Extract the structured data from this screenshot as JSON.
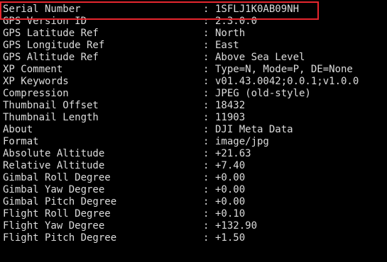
{
  "accent": {
    "highlight_border": "#e6262e",
    "text": "#dcdcdc",
    "background": "#000000"
  },
  "rows": [
    {
      "label": "Serial Number",
      "value": "1SFLJ1K0AB09NH"
    },
    {
      "label": "GPS Version ID",
      "value": "2.3.0.0"
    },
    {
      "label": "GPS Latitude Ref",
      "value": "North"
    },
    {
      "label": "GPS Longitude Ref",
      "value": "East"
    },
    {
      "label": "GPS Altitude Ref",
      "value": "Above Sea Level"
    },
    {
      "label": "XP Comment",
      "value": "Type=N, Mode=P, DE=None"
    },
    {
      "label": "XP Keywords",
      "value": "v01.43.0042;0.0.1;v1.0.0"
    },
    {
      "label": "Compression",
      "value": "JPEG (old-style)"
    },
    {
      "label": "Thumbnail Offset",
      "value": "18432"
    },
    {
      "label": "Thumbnail Length",
      "value": "11903"
    },
    {
      "label": "About",
      "value": "DJI Meta Data"
    },
    {
      "label": "Format",
      "value": "image/jpg"
    },
    {
      "label": "Absolute Altitude",
      "value": "+21.63"
    },
    {
      "label": "Relative Altitude",
      "value": "+7.40"
    },
    {
      "label": "Gimbal Roll Degree",
      "value": "+0.00"
    },
    {
      "label": "Gimbal Yaw Degree",
      "value": "+0.00"
    },
    {
      "label": "Gimbal Pitch Degree",
      "value": "+0.00"
    },
    {
      "label": "Flight Roll Degree",
      "value": "+0.10"
    },
    {
      "label": "Flight Yaw Degree",
      "value": "+132.90"
    },
    {
      "label": "Flight Pitch Degree",
      "value": "+1.50"
    }
  ],
  "separator": ":"
}
